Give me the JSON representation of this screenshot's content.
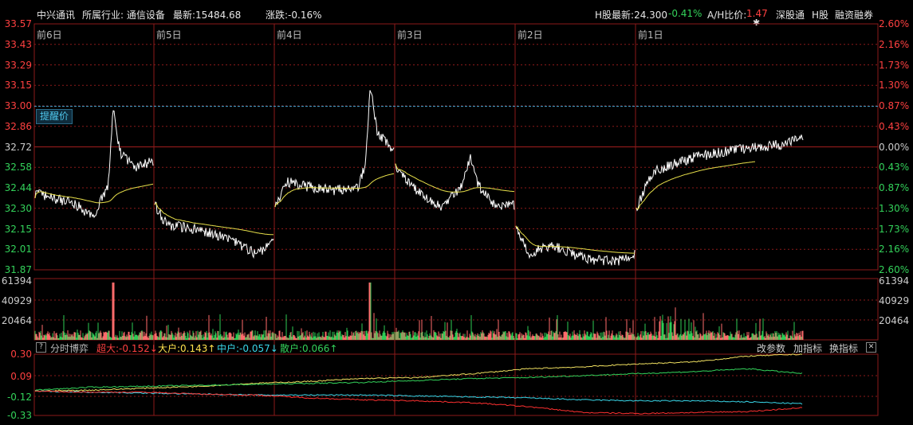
{
  "top_bar": {
    "stock_name": "中兴通讯",
    "industry": "所属行业: 通信设备",
    "latest": "最新:15484.68",
    "change": "涨跌:-0.16%",
    "h_latest": "H股最新:24.300",
    "h_change": "-0.41%",
    "ah_ratio_label": "A/H比价:",
    "ah_ratio_value": "1.47",
    "btn_shenzhen_connect": "深股通",
    "btn_h_share": "H股",
    "btn_margin": "融资融券"
  },
  "price_chart": {
    "left_axis": [
      "33.57",
      "33.43",
      "33.29",
      "33.15",
      "33.00",
      "32.86",
      "32.72",
      "32.58",
      "32.44",
      "32.30",
      "32.15",
      "32.01",
      "31.87"
    ],
    "right_axis": [
      "2.60%",
      "2.16%",
      "1.73%",
      "1.30%",
      "0.87%",
      "0.43%",
      "0.00%",
      "0.43%",
      "0.87%",
      "1.30%",
      "1.73%",
      "2.16%",
      "2.60%"
    ],
    "day_labels": [
      "前6日",
      "前5日",
      "前4日",
      "前3日",
      "前2日",
      "前1日"
    ],
    "reminder_label": "提醒价",
    "reminder_price": 33.0,
    "ylim": [
      31.87,
      33.57
    ],
    "prev_close": 32.72
  },
  "volume_chart": {
    "left_axis": [
      "61394",
      "40929",
      "20464"
    ],
    "right_axis": [
      "61394",
      "40929",
      "20464"
    ],
    "max": 61394
  },
  "indicator": {
    "help_icon": "?",
    "name": "分时博弈",
    "super_large": "超大:-0.152↓",
    "large": "大户:0.143↑",
    "medium": "中户:-0.057↓",
    "retail": "散户:0.066↑",
    "btn_change_params": "改参数",
    "btn_add_indicator": "加指标",
    "btn_switch_indicator": "换指标",
    "close_icon": "✕",
    "axis": [
      "0.30",
      "0.09",
      "-0.12",
      "-0.33"
    ],
    "ylim": [
      -0.33,
      0.3
    ]
  },
  "colors": {
    "price_line": "#ffffff",
    "avg_line": "#e8e04a",
    "grid": "#8b1a1a",
    "ref_line": "#3fa9d6",
    "axis_up": "#ff4040",
    "axis_down": "#33d25a",
    "vol_up": "#ff6b6b",
    "vol_down": "#2ecc55",
    "super_large": "#ff3030",
    "large": "#f0e060",
    "medium": "#39d6e8",
    "retail": "#33d25a"
  }
}
